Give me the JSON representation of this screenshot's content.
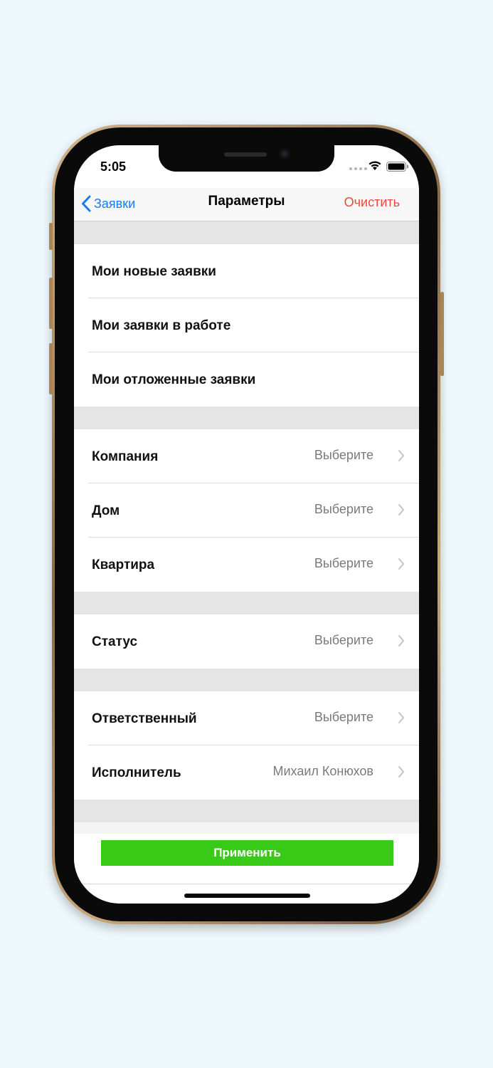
{
  "status_bar": {
    "time": "5:05"
  },
  "navbar": {
    "back_label": "Заявки",
    "title": "Параметры",
    "clear_label": "Очистить"
  },
  "groups": [
    {
      "rows": [
        {
          "label": "Мои новые заявки"
        },
        {
          "label": "Мои заявки в работе"
        },
        {
          "label": "Мои отложенные заявки"
        }
      ]
    },
    {
      "rows": [
        {
          "label": "Компания",
          "value": "Выберите"
        },
        {
          "label": "Дом",
          "value": "Выберите"
        },
        {
          "label": "Квартира",
          "value": "Выберите"
        }
      ]
    },
    {
      "rows": [
        {
          "label": "Статус",
          "value": "Выберите"
        }
      ]
    },
    {
      "rows": [
        {
          "label": "Ответственный",
          "value": "Выберите"
        },
        {
          "label": "Исполнитель",
          "value": "Михаил Конюхов"
        }
      ]
    }
  ],
  "apply_label": "Применить",
  "colors": {
    "accent_blue": "#1a7cf0",
    "clear_red": "#f0453a",
    "apply_green": "#39c917"
  }
}
